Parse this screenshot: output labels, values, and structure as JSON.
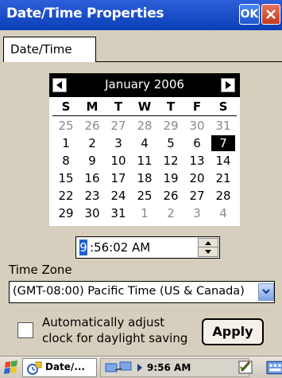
{
  "window": {
    "title": "Date/Time Properties",
    "ok_label": "OK"
  },
  "tabs": [
    {
      "label": "Date/Time"
    }
  ],
  "calendar": {
    "month_label": "January 2006",
    "weekdays": [
      "S",
      "M",
      "T",
      "W",
      "T",
      "F",
      "S"
    ],
    "weeks": [
      [
        "25",
        "26",
        "27",
        "28",
        "29",
        "30",
        "31"
      ],
      [
        "1",
        "2",
        "3",
        "4",
        "5",
        "6",
        "7"
      ],
      [
        "8",
        "9",
        "10",
        "11",
        "12",
        "13",
        "14"
      ],
      [
        "15",
        "16",
        "17",
        "18",
        "19",
        "20",
        "21"
      ],
      [
        "22",
        "23",
        "24",
        "25",
        "26",
        "27",
        "28"
      ],
      [
        "29",
        "30",
        "31",
        "1",
        "2",
        "3",
        "4"
      ]
    ],
    "muted_rows": {
      "0": [
        0,
        1,
        2,
        3,
        4,
        5,
        6
      ],
      "5": [
        3,
        4,
        5,
        6
      ]
    },
    "selected": {
      "week": 1,
      "day": 6
    }
  },
  "time": {
    "hour": "9",
    "rest": ":56:02 AM"
  },
  "timezone": {
    "label": "Time Zone",
    "value": "(GMT-08:00) Pacific Time (US & Canada)"
  },
  "dst": {
    "line1": "Automatically adjust",
    "line2": "clock for daylight saving",
    "checked": false
  },
  "buttons": {
    "apply_label": "Apply"
  },
  "taskbar": {
    "task_label": "Date/...",
    "clock": "9:56 AM"
  },
  "colors": {
    "titlebar": "#1a4cd0",
    "window_bg": "#d7cfbd",
    "selection": "#1f5fcf"
  }
}
